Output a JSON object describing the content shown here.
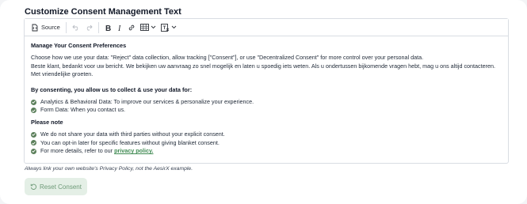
{
  "heading": "Customize Consent Management Text",
  "toolbar": {
    "source_label": "Source",
    "icons": [
      "source-icon",
      "undo-icon",
      "redo-icon",
      "bold-icon",
      "italic-icon",
      "link-icon",
      "table-icon",
      "chevron-down-icon",
      "remove-format-icon",
      "chevron-down-icon"
    ]
  },
  "content": {
    "title": "Manage Your Consent Preferences",
    "intro_line1": "Choose how we use your data: \"Reject\" data collection, allow tracking [\"Consent\"], or use \"Decentralized Consent\" for more control over your personal data.",
    "intro_line2": "Beste klant, bedankt voor uw bericht. We bekijken uw aanvraag zo snel mogelijk en laten u spoedig iets weten. Als u ondertussen bijkomende vragen hebt, mag u ons altijd contacteren. Met vriendelijke groeten.",
    "consent_heading": "By consenting, you allow us to collect & use your data for:",
    "consent_items": [
      "Analytics & Behavioral Data: To improve our services & personalize your experience.",
      "Form Data: When you contact us."
    ],
    "note_heading": "Please note",
    "note_items": [
      "We do not share your data with third parties without your explicit consent.",
      "You can opt-in later for specific features without giving blanket consent."
    ],
    "last_item_prefix": "For more details, refer to our ",
    "last_item_link": "privacy policy."
  },
  "footer_note": "Always link your own website's Privacy Policy, not the AesirX example.",
  "reset_button": "Reset Consent",
  "colors": {
    "accent": "#3f8a52",
    "check": "#5b7f5a",
    "reset_bg": "#e4efe6",
    "reset_text": "#6e9a78"
  }
}
